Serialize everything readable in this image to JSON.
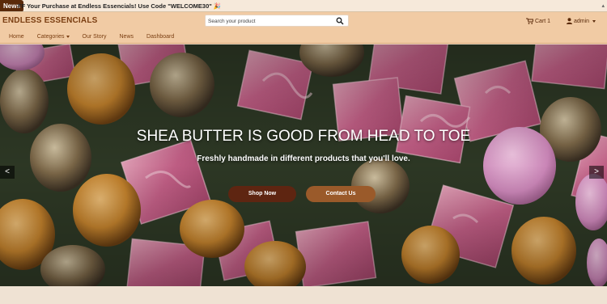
{
  "ticker": {
    "badge": "News",
    "text": "FF Your Purchase at Endless Essencials! Use Code \"WELCOME30\" 🎉",
    "close": "▴"
  },
  "header": {
    "brand": "ENDLESS ESSENCIALS",
    "search_placeholder": "Search your product",
    "cart_label": "Cart 1",
    "user_label": "admin"
  },
  "nav": {
    "items": [
      {
        "label": "Home",
        "dropdown": false
      },
      {
        "label": "Categories",
        "dropdown": true
      },
      {
        "label": "Our Story",
        "dropdown": false
      },
      {
        "label": "News",
        "dropdown": false
      },
      {
        "label": "Dashboard",
        "dropdown": false
      }
    ]
  },
  "hero": {
    "title": "SHEA BUTTER IS GOOD FROM HEAD TO TOE",
    "subtitle": "Freshly handmade in different products that you'll love.",
    "shop_button": "Shop Now",
    "contact_button": "Contact Us",
    "prev_arrow": "<",
    "next_arrow": ">"
  },
  "colors": {
    "header_bg": "#f1cba4",
    "brand": "#7a3e12",
    "shop_button": "#5e2511",
    "contact_button": "#9a5a2a"
  },
  "icons": {
    "search": "search-icon",
    "cart": "cart-icon",
    "user": "user-icon"
  }
}
